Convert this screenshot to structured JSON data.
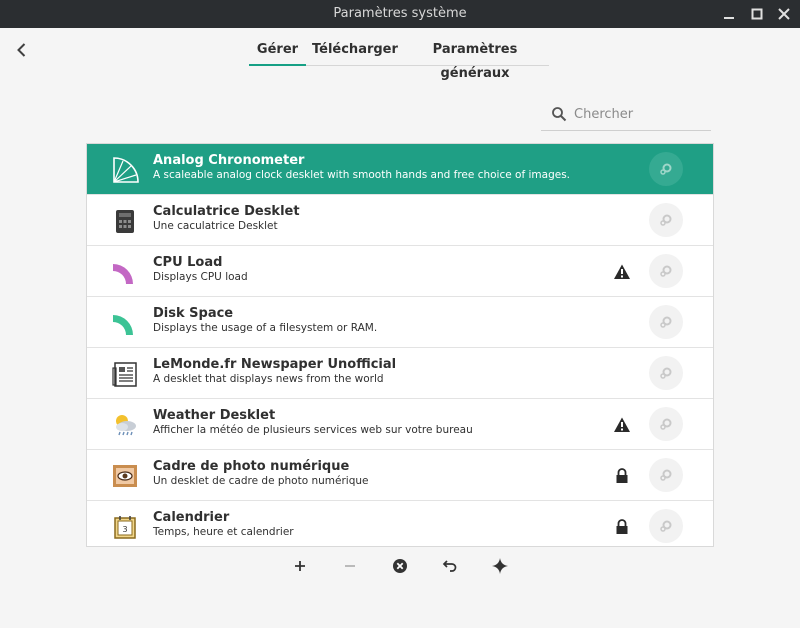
{
  "window": {
    "title": "Paramètres système",
    "controls": [
      "minimize-icon",
      "maximize-icon",
      "close-icon"
    ]
  },
  "nav": {
    "back_icon": "back-arrow-icon"
  },
  "tabs": [
    {
      "label": "Gérer",
      "active": true
    },
    {
      "label": "Télécharger",
      "active": false
    },
    {
      "label": "Paramètres généraux",
      "active": false
    }
  ],
  "search": {
    "placeholder": "Chercher",
    "value": "",
    "icon": "search-icon"
  },
  "colors": {
    "accent": "#1f9f85",
    "tab_underline": "#16a085",
    "titlebar": "#2b2e31"
  },
  "desklets": [
    {
      "name": "Analog Chronometer",
      "description": "A scaleable analog clock desklet with smooth hands and free choice of images.",
      "icon": "clock-icon",
      "status": "",
      "selected": true
    },
    {
      "name": "Calculatrice Desklet",
      "description": "Une caculatrice Desklet",
      "icon": "calculator-icon",
      "status": "",
      "selected": false
    },
    {
      "name": "CPU Load",
      "description": "Displays CPU load",
      "icon": "cpu-gauge-icon",
      "status": "warning-icon",
      "selected": false
    },
    {
      "name": "Disk Space",
      "description": "Displays the usage of a filesystem or RAM.",
      "icon": "disk-gauge-icon",
      "status": "",
      "selected": false
    },
    {
      "name": "LeMonde.fr Newspaper Unofficial",
      "description": "A desklet that displays news from the world",
      "icon": "newspaper-icon",
      "status": "",
      "selected": false
    },
    {
      "name": "Weather Desklet",
      "description": "Afficher la météo de plusieurs services web sur votre bureau",
      "icon": "weather-icon",
      "status": "warning-icon",
      "selected": false
    },
    {
      "name": "Cadre de photo numérique",
      "description": "Un desklet de cadre de photo numérique",
      "icon": "photo-frame-icon",
      "status": "lock-icon",
      "selected": false
    },
    {
      "name": "Calendrier",
      "description": "Temps, heure et calendrier",
      "icon": "calendar-icon",
      "status": "lock-icon",
      "selected": false
    }
  ],
  "toolbar": {
    "buttons": [
      {
        "icon": "add-icon",
        "enabled": true
      },
      {
        "icon": "remove-icon",
        "enabled": false
      },
      {
        "icon": "clear-icon",
        "enabled": true
      },
      {
        "icon": "undo-icon",
        "enabled": true
      },
      {
        "icon": "sparkle-icon",
        "enabled": true
      }
    ]
  }
}
